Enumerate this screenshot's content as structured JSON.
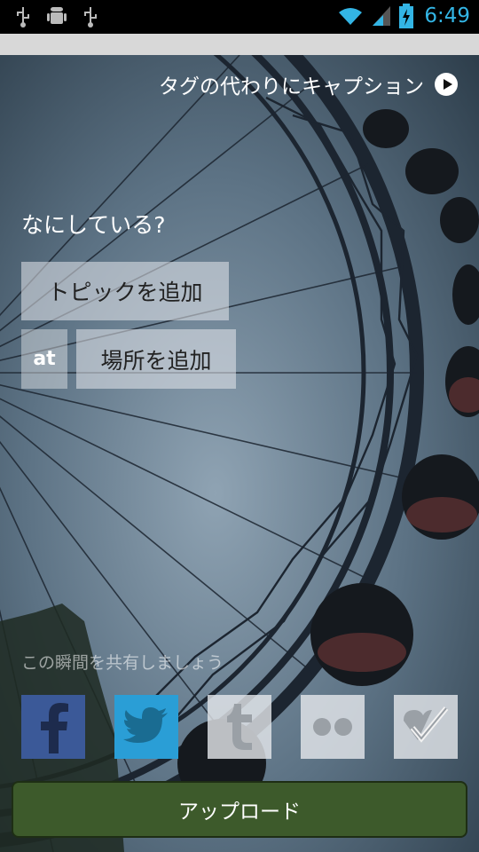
{
  "status_bar": {
    "time": "6:49",
    "icons_left": [
      "usb-icon",
      "android-debug-icon",
      "usb-icon"
    ],
    "icons_right": [
      "wifi-icon",
      "signal-icon",
      "battery-charging-icon"
    ],
    "accent_color": "#33b5e5"
  },
  "caption_toggle": {
    "label": "タグの代わりにキャプション",
    "icon": "play-circle-icon"
  },
  "compose": {
    "question": "なにしている?",
    "topic_button": "トピックを追加",
    "at_label": "at",
    "place_button": "場所を追加"
  },
  "share": {
    "label": "この瞬間を共有しましょう",
    "services": [
      {
        "name": "facebook",
        "icon": "facebook-icon",
        "color": "#3b5998",
        "enabled": true
      },
      {
        "name": "twitter",
        "icon": "twitter-icon",
        "color": "#2a9ed6",
        "enabled": true
      },
      {
        "name": "tumblr",
        "icon": "tumblr-icon",
        "enabled": false
      },
      {
        "name": "flickr",
        "icon": "flickr-icon",
        "enabled": false
      },
      {
        "name": "foursquare",
        "icon": "foursquare-icon",
        "enabled": false
      }
    ]
  },
  "upload_button": {
    "label": "アップロード",
    "color": "#3d5a2b"
  }
}
